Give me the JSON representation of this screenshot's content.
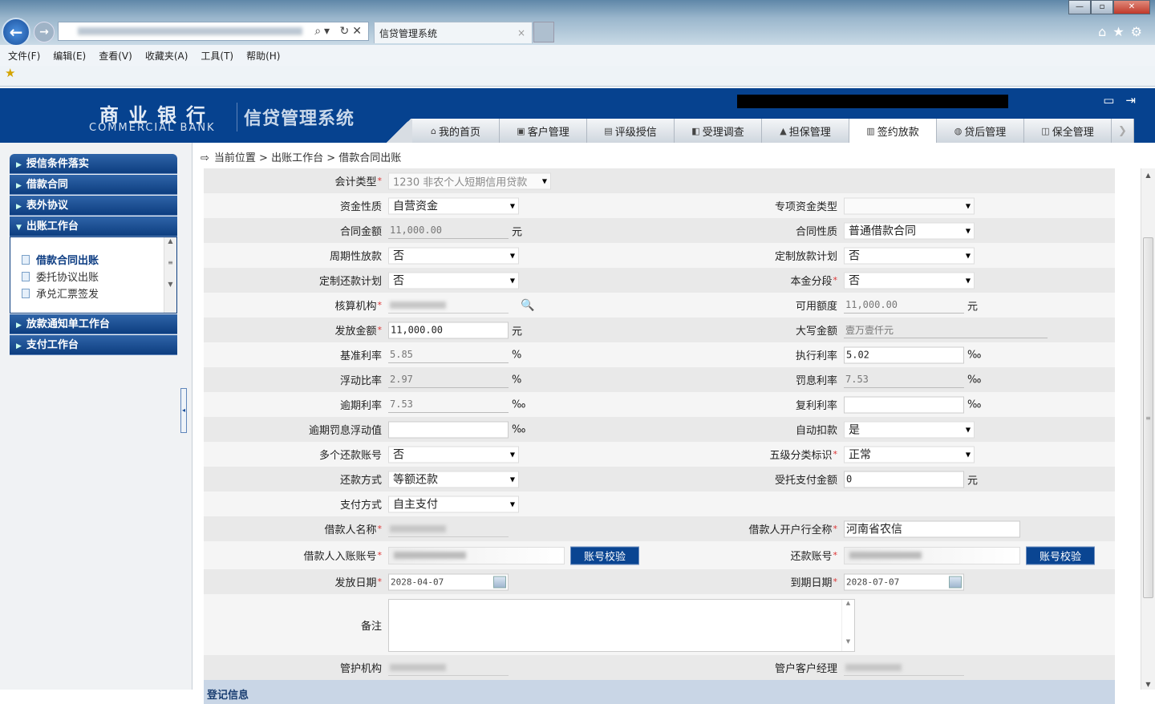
{
  "browser": {
    "tab_title": "信贷管理系统",
    "menu": [
      "文件(F)",
      "编辑(E)",
      "查看(V)",
      "收藏夹(A)",
      "工具(T)",
      "帮助(H)"
    ]
  },
  "header": {
    "bank_cn": "商业银行",
    "bank_en": "COMMERCIAL BANK",
    "system_name": "信贷管理系统",
    "nav": [
      {
        "icon": "home-icon",
        "glyph": "⌂",
        "label": "我的首页"
      },
      {
        "icon": "customer-icon",
        "glyph": "▣",
        "label": "客户管理"
      },
      {
        "icon": "rating-icon",
        "glyph": "▤",
        "label": "评级授信"
      },
      {
        "icon": "survey-icon",
        "glyph": "◧",
        "label": "受理调查"
      },
      {
        "icon": "guarantee-icon",
        "glyph": "▲",
        "label": "担保管理"
      },
      {
        "icon": "contract-icon",
        "glyph": "▥",
        "label": "签约放款",
        "active": true
      },
      {
        "icon": "postloan-icon",
        "glyph": "◍",
        "label": "贷后管理"
      },
      {
        "icon": "preserve-icon",
        "glyph": "◫",
        "label": "保全管理"
      }
    ]
  },
  "sidebar": {
    "groups": [
      "授信条件落实",
      "借款合同",
      "表外协议",
      "出账工作台",
      "放款通知单工作台",
      "支付工作台"
    ],
    "items": [
      "借款合同出账",
      "委托协议出账",
      "承兑汇票签发"
    ]
  },
  "breadcrumb": "当前位置 > 出账工作台 > 借款合同出账",
  "form": {
    "rows": [
      {
        "l": {
          "label": "会计类型",
          "req": true,
          "type": "select",
          "value": "1230 非农个人短期信用贷款",
          "wide": true,
          "disabled": true
        }
      },
      {
        "l": {
          "label": "资金性质",
          "type": "select",
          "value": "自营资金"
        },
        "r": {
          "label": "专项资金类型",
          "type": "select",
          "value": "",
          "disabled": true
        }
      },
      {
        "l": {
          "label": "合同金额",
          "type": "ro",
          "value": "11,000.00",
          "unit": "元"
        },
        "r": {
          "label": "合同性质",
          "type": "select",
          "value": "普通借款合同"
        }
      },
      {
        "l": {
          "label": "周期性放款",
          "type": "select",
          "value": "否"
        },
        "r": {
          "label": "定制放款计划",
          "type": "select",
          "value": "否"
        }
      },
      {
        "l": {
          "label": "定制还款计划",
          "type": "select",
          "value": "否"
        },
        "r": {
          "label": "本金分段",
          "req": true,
          "type": "select",
          "value": "否"
        }
      },
      {
        "l": {
          "label": "核算机构",
          "req": true,
          "type": "blur",
          "search": true
        },
        "r": {
          "label": "可用额度",
          "type": "ro",
          "value": "11,000.00",
          "unit": "元"
        }
      },
      {
        "l": {
          "label": "发放金额",
          "req": true,
          "type": "input",
          "value": "11,000.00",
          "unit": "元"
        },
        "r": {
          "label": "大写金额",
          "type": "ro",
          "value": "壹万壹仟元",
          "wide": true
        }
      },
      {
        "l": {
          "label": "基准利率",
          "type": "ro",
          "value": "5.85",
          "unit": "%"
        },
        "r": {
          "label": "执行利率",
          "type": "input",
          "value": "5.02",
          "unit": "‰"
        }
      },
      {
        "l": {
          "label": "浮动比率",
          "type": "ro",
          "value": "2.97",
          "unit": "%"
        },
        "r": {
          "label": "罚息利率",
          "type": "ro",
          "value": "7.53",
          "unit": "‰"
        }
      },
      {
        "l": {
          "label": "逾期利率",
          "type": "ro",
          "value": "7.53",
          "unit": "‰"
        },
        "r": {
          "label": "复利利率",
          "type": "input",
          "value": "",
          "unit": "‰"
        }
      },
      {
        "l": {
          "label": "逾期罚息浮动值",
          "type": "input",
          "value": "",
          "unit": "‰"
        },
        "r": {
          "label": "自动扣款",
          "type": "select",
          "value": "是"
        }
      },
      {
        "l": {
          "label": "多个还款账号",
          "type": "select",
          "value": "否"
        },
        "r": {
          "label": "五级分类标识",
          "req": true,
          "type": "select",
          "value": "正常"
        }
      },
      {
        "l": {
          "label": "还款方式",
          "type": "select",
          "value": "等额还款"
        },
        "r": {
          "label": "受托支付金额",
          "type": "input",
          "value": "0",
          "unit": "元"
        }
      },
      {
        "l": {
          "label": "支付方式",
          "type": "select",
          "value": "自主支付"
        }
      },
      {
        "l": {
          "label": "借款人名称",
          "req": true,
          "type": "blur"
        },
        "r": {
          "label": "借款人开户行全称",
          "req": true,
          "type": "input",
          "value": "河南省农信",
          "wide": true
        }
      },
      {
        "tall": true,
        "l": {
          "label": "借款人入账账号",
          "req": true,
          "type": "blurin",
          "button": "账号校验"
        },
        "r": {
          "label": "还款账号",
          "req": true,
          "type": "blurin",
          "button": "账号校验"
        }
      },
      {
        "l": {
          "label": "发放日期",
          "req": true,
          "type": "date",
          "value": "2028-04-07"
        },
        "r": {
          "label": "到期日期",
          "req": true,
          "type": "date",
          "value": "2028-07-07"
        }
      },
      {
        "textarea": true,
        "l": {
          "label": "备注",
          "type": "textarea"
        }
      },
      {
        "l": {
          "label": "管护机构",
          "type": "blur"
        },
        "r": {
          "label": "管户客户经理",
          "type": "blur"
        }
      }
    ],
    "section": "登记信息"
  }
}
